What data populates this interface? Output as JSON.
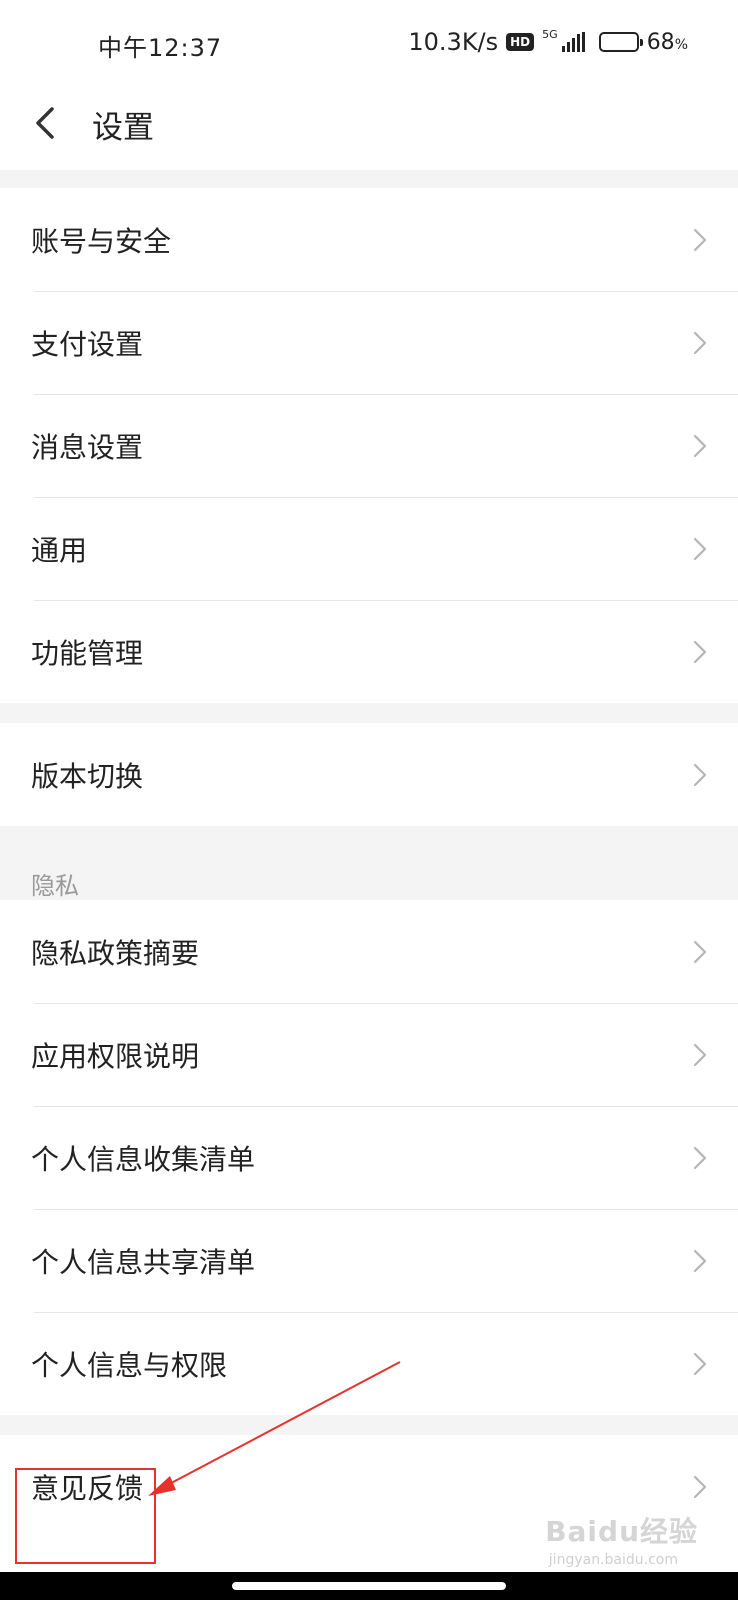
{
  "status_bar": {
    "time": "中午12:37",
    "network_speed": "10.3K/s",
    "hd_badge": "HD",
    "network_type": "5G",
    "battery_percent": "68",
    "battery_unit": "%",
    "battery_level": 0.68,
    "battery_color": "#f5a623"
  },
  "header": {
    "back_icon": "chevron-left-icon",
    "title": "设置"
  },
  "group1": [
    {
      "label": "账号与安全"
    },
    {
      "label": "支付设置"
    },
    {
      "label": "消息设置"
    },
    {
      "label": "通用"
    },
    {
      "label": "功能管理"
    }
  ],
  "group2": [
    {
      "label": "版本切换"
    }
  ],
  "privacy": {
    "section_title": "隐私",
    "items": [
      {
        "label": "隐私政策摘要"
      },
      {
        "label": "应用权限说明"
      },
      {
        "label": "个人信息收集清单"
      },
      {
        "label": "个人信息共享清单"
      },
      {
        "label": "个人信息与权限"
      }
    ]
  },
  "group4": [
    {
      "label": "意见反馈"
    }
  ],
  "annotation": {
    "color": "#e5322d"
  },
  "watermark": {
    "brand": "Baidu经验",
    "url": "jingyan.baidu.com"
  }
}
